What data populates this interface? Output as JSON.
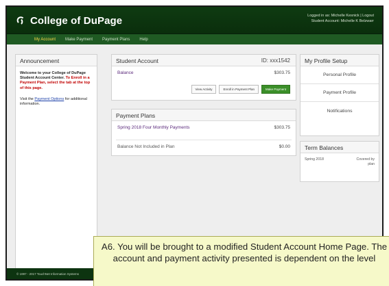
{
  "header": {
    "logo_text": "College of DuPage",
    "logo_icon": "cod-logo-icon",
    "user_line_1": "Logged in as: Michelle Kesnick | Logout",
    "user_line_2": "Student Account: Michelle K Belzwarr"
  },
  "nav": {
    "items": [
      {
        "label": "My Account"
      },
      {
        "label": "Make Payment"
      },
      {
        "label": "Payment Plans"
      },
      {
        "label": "Help"
      }
    ]
  },
  "announcement": {
    "title": "Announcement",
    "welcome": "Welcome to your College of DuPage Student Account Center.",
    "instruction": "To Enroll in a Payment Plan, select the tab at the top of this page.",
    "visit_prefix": "Visit the",
    "link": "Payment Options",
    "visit_suffix": "for additional information."
  },
  "student_account": {
    "title": "Student Account",
    "id": "ID: xxx1542",
    "balance_label": "Balance",
    "balance_amount": "$303.75",
    "buttons": {
      "view_activity": "View Activity",
      "enroll": "Enroll in Payment Plan",
      "make_payment": "Make Payment"
    }
  },
  "payment_plans": {
    "title": "Payment Plans",
    "plan_name": "Spring 2018 Four Monthly Payments",
    "plan_amount": "$303.75",
    "not_included_label": "Balance Not Included in Plan",
    "not_included_amount": "$0.00"
  },
  "profile": {
    "title": "My Profile Setup",
    "items": [
      "Personal Profile",
      "Payment Profile",
      "Notifications"
    ]
  },
  "term_balances": {
    "title": "Term Balances",
    "term": "Spring 2018",
    "status": "Covered by plan"
  },
  "footer": {
    "text": "© 1997 - 2017 TouchNet Information Systems"
  },
  "callout": {
    "text": "A6. You will be brought to a modified Student Account Home Page. The account and payment activity presented is dependent on the level"
  },
  "colors": {
    "header": "#0f3b12",
    "nav": "#1f5a23",
    "active_nav": "#ffd84a",
    "button_green": "#3b8f29",
    "link_purple": "#5b2a7c",
    "announcement_red": "#c00000"
  }
}
